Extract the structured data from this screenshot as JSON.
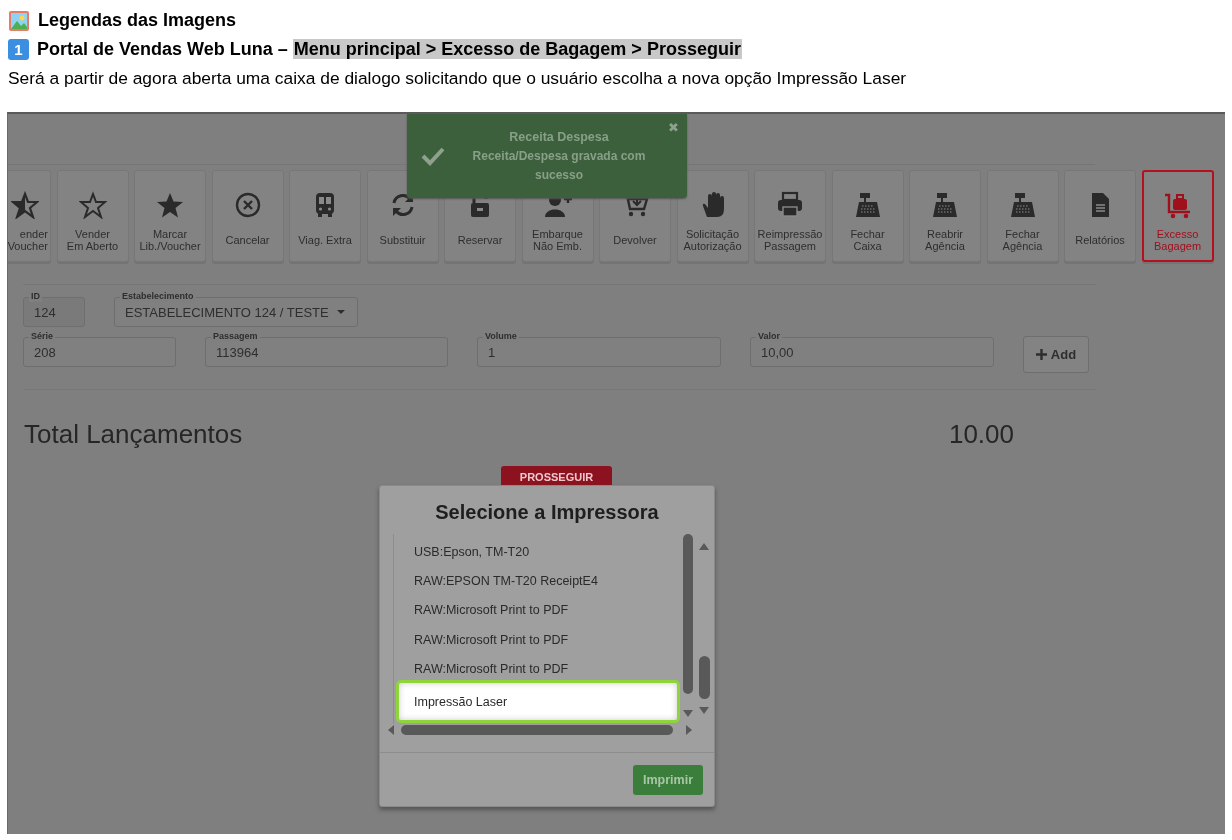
{
  "document": {
    "heading": "Legendas das Imagens",
    "step_number": "1",
    "step_title": "Portal de Vendas Web Luna – ",
    "step_path": "Menu principal > Excesso de Bagagem > Prosseguir",
    "description": "Será a partir de agora aberta uma caixa de dialogo solicitando que o usuário escolha a nova opção Impressão Laser"
  },
  "toast": {
    "title": "Receita Despesa",
    "message": "Receita/Despesa gravada com sucesso",
    "close": "✖"
  },
  "toolbar": [
    {
      "label": "ender\nVoucher",
      "selected": false
    },
    {
      "label": "Vender\nEm Aberto",
      "selected": false
    },
    {
      "label": "Marcar\nLib./Voucher",
      "selected": false
    },
    {
      "label": "Cancelar",
      "selected": false
    },
    {
      "label": "Viag. Extra",
      "selected": false
    },
    {
      "label": "Substituir",
      "selected": false
    },
    {
      "label": "Reservar",
      "selected": false
    },
    {
      "label": "Embarque\nNão Emb.",
      "selected": false
    },
    {
      "label": "Devolver",
      "selected": false
    },
    {
      "label": "Solicitação\nAutorização",
      "selected": false
    },
    {
      "label": "Reimpressão\nPassagem",
      "selected": false
    },
    {
      "label": "Fechar\nCaixa",
      "selected": false
    },
    {
      "label": "Reabrir\nAgência",
      "selected": false
    },
    {
      "label": "Fechar\nAgência",
      "selected": false
    },
    {
      "label": "Relatórios",
      "selected": false
    },
    {
      "label": "Excesso\nBagagem",
      "selected": true
    }
  ],
  "form": {
    "rows": [
      [
        {
          "label": "ID",
          "value": "124",
          "kind": "readonly"
        },
        {
          "label": "Estabelecimento",
          "value": "ESTABELECIMENTO 124 / TESTE",
          "kind": "select"
        }
      ],
      [
        {
          "label": "Série",
          "value": "208",
          "kind": "input"
        },
        {
          "label": "Passagem",
          "value": "113964",
          "kind": "input"
        },
        {
          "label": "Volume",
          "value": "1",
          "kind": "input"
        },
        {
          "label": "Valor",
          "value": "10,00",
          "kind": "input"
        }
      ]
    ],
    "add_button": "Add"
  },
  "total": {
    "label": "Total Lançamentos",
    "value": "10.00"
  },
  "proceed_button": "PROSSEGUIR",
  "dialog": {
    "title": "Selecione a Impressora",
    "printers": [
      {
        "name": "USB:Epson, TM-T20",
        "selected": false
      },
      {
        "name": "RAW:EPSON TM-T20 ReceiptE4",
        "selected": false
      },
      {
        "name": "RAW:Microsoft Print to PDF",
        "selected": false
      },
      {
        "name": "RAW:Microsoft Print to PDF",
        "selected": false
      },
      {
        "name": "RAW:Microsoft Print to PDF",
        "selected": false
      },
      {
        "name": "Impressão Laser",
        "selected": true
      }
    ],
    "button": "Imprimir"
  }
}
